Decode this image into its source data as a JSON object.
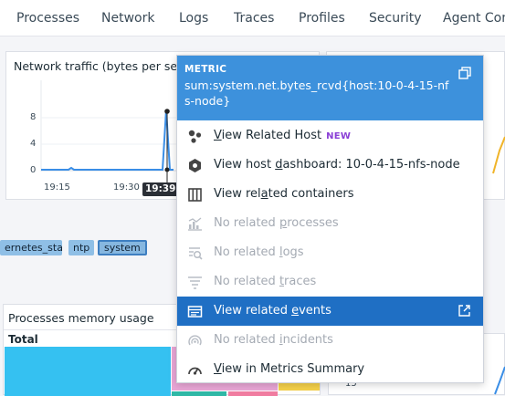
{
  "nav": {
    "tabs": [
      "Processes",
      "Network",
      "Logs",
      "Traces",
      "Profiles",
      "Security",
      "Agent Conf"
    ]
  },
  "network_panel": {
    "title": "Network traffic (bytes per sec)",
    "chart_data": {
      "type": "line",
      "y_ticks": [
        "8",
        "4",
        "0"
      ],
      "x_ticks": [
        "19:15",
        "19:30",
        "19:39:"
      ],
      "ylim": [
        0,
        10
      ]
    }
  },
  "tags": [
    "ernetes_state",
    "ntp",
    "system"
  ],
  "memory_panel": {
    "title": "Processes memory usage",
    "legend_title": "Total"
  },
  "right_panel_tick": "15",
  "menu": {
    "kicker": "METRIC",
    "metric": "sum:system.net.bytes_rcvd{host:10-0-4-15-nfs-node}",
    "items": [
      {
        "icon": "related-host-icon",
        "pre": "",
        "ul": "V",
        "post": "iew Related Host",
        "badge": "NEW"
      },
      {
        "icon": "host-dashboard-icon",
        "pre": "View host ",
        "ul": "d",
        "post": "ashboard: 10-0-4-15-nfs-node"
      },
      {
        "icon": "containers-icon",
        "pre": "View rel",
        "ul": "a",
        "post": "ted containers"
      },
      {
        "icon": "processes-icon",
        "pre": "No related ",
        "ul": "p",
        "post": "rocesses"
      },
      {
        "icon": "logs-icon",
        "pre": "No related ",
        "ul": "l",
        "post": "ogs"
      },
      {
        "icon": "traces-icon",
        "pre": "No related ",
        "ul": "t",
        "post": "races"
      },
      {
        "icon": "events-icon",
        "pre": "View related ",
        "ul": "e",
        "post": "vents"
      },
      {
        "icon": "incidents-icon",
        "pre": "No related ",
        "ul": "i",
        "post": "ncidents"
      },
      {
        "icon": "metrics-summary-icon",
        "pre": "",
        "ul": "V",
        "post": "iew in Metrics Summary"
      }
    ]
  },
  "colors": {
    "accent": "#3d91dc",
    "active": "#1f6fc4",
    "badge_new": "#8a3fd6",
    "series": "#3a8ee6"
  }
}
